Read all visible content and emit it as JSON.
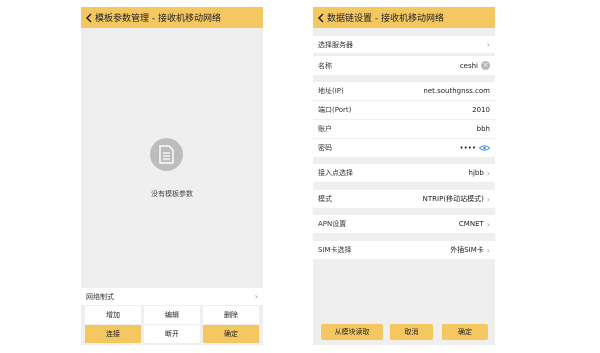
{
  "left": {
    "title": "模板参数管理 - 接收机移动网络",
    "empty_text": "没有模板参数",
    "network_row": {
      "label": "网络制式"
    },
    "buttons": {
      "add": "增加",
      "edit": "编辑",
      "delete": "删除",
      "connect": "连接",
      "disconnect": "断开",
      "confirm": "确定"
    }
  },
  "right": {
    "title": "数据链设置 - 接收机移动网络",
    "rows": {
      "server": {
        "label": "选择服务器"
      },
      "name": {
        "label": "名称",
        "value": "ceshi"
      },
      "address": {
        "label": "地址(IP)",
        "value": "net.southgnss.com"
      },
      "port": {
        "label": "端口(Port)",
        "value": "2010"
      },
      "account": {
        "label": "账户",
        "value": "bbh"
      },
      "password": {
        "label": "密码",
        "value": "••••"
      },
      "mountpoint": {
        "label": "接入点选择",
        "value": "hjbb"
      },
      "mode": {
        "label": "模式",
        "value": "NTRIP(移动站模式)"
      },
      "apn": {
        "label": "APN设置",
        "value": "CMNET"
      },
      "sim": {
        "label": "SIM卡选择",
        "value": "外插SIM卡"
      }
    },
    "buttons": {
      "read_from_module": "从模块读取",
      "cancel": "取消",
      "confirm": "确定"
    }
  },
  "colors": {
    "accent": "#f4c760",
    "background": "#efefef",
    "eye_icon": "#4a90e2"
  },
  "icons": [
    "back-arrow-icon",
    "document-icon",
    "chevron-right-icon",
    "clear-icon",
    "eye-icon"
  ]
}
